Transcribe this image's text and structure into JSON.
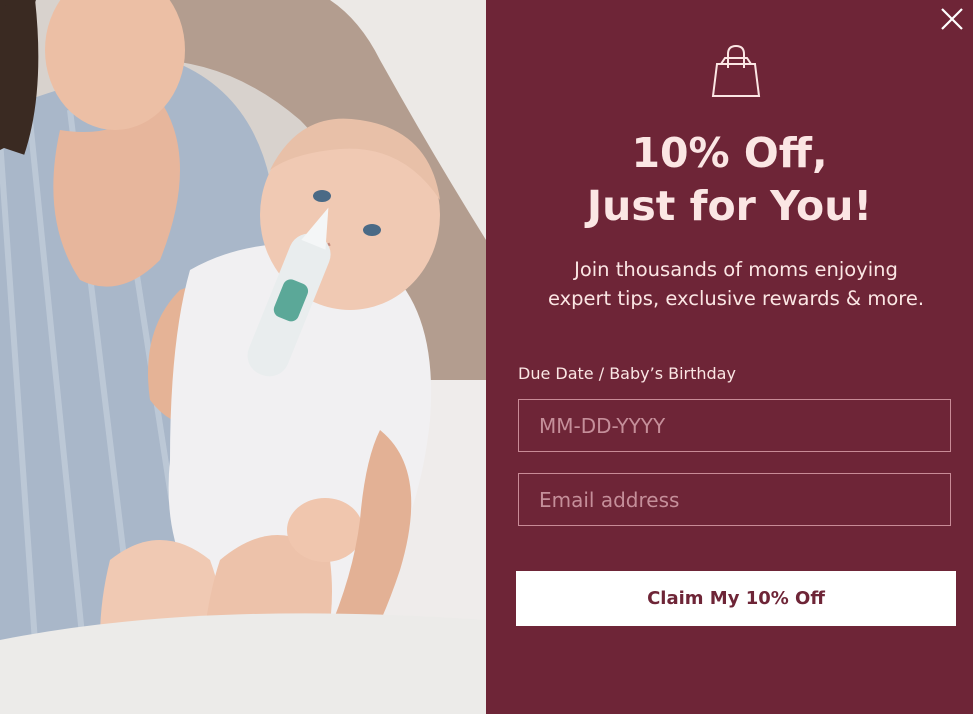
{
  "popup": {
    "headline_line1": "10% Off,",
    "headline_line2": "Just for You!",
    "subtext_line1": "Join thousands of moms enjoying",
    "subtext_line2": "expert tips, exclusive rewards & more.",
    "due_date_label": "Due Date / Baby’s Birthday",
    "due_date_placeholder": "MM-DD-YYYY",
    "email_placeholder": "Email address",
    "cta_label": "Claim My 10% Off"
  },
  "icons": {
    "close": "close-icon",
    "bag": "shopping-bag-icon"
  },
  "colors": {
    "panel_bg": "#6e2537",
    "headline_text": "#fbe6e4",
    "button_bg": "#ffffff",
    "button_text": "#6e2537"
  }
}
